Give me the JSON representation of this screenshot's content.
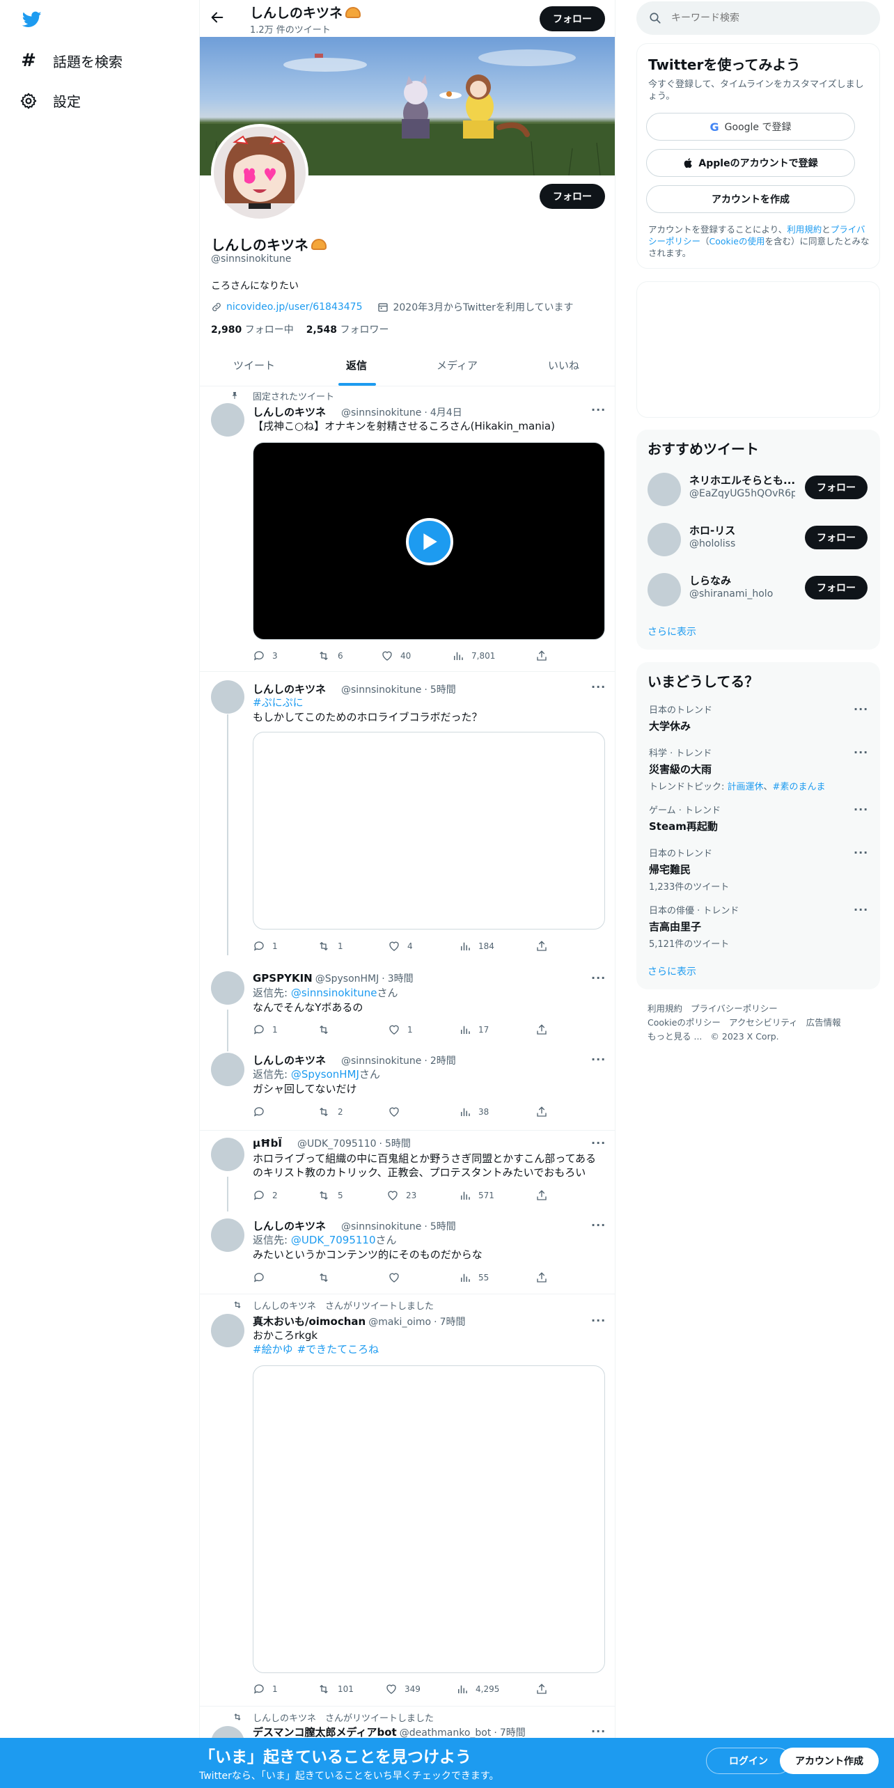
{
  "nav": {
    "explore": "話題を検索",
    "settings": "設定"
  },
  "header": {
    "name": "しんしのキツネ",
    "tweet_count": "1.2万 件のツイート",
    "follow": "フォロー"
  },
  "profile": {
    "name": "しんしのキツネ",
    "handle": "@sinnsinokitune",
    "bio": "ころさんになりたい",
    "link": "nicovideo.jp/user/61843475",
    "joined": "2020年3月からTwitterを利用しています",
    "following_count": "2,980",
    "following_label": "フォロー中",
    "followers_count": "2,548",
    "followers_label": "フォロワー",
    "follow": "フォロー"
  },
  "tabs": {
    "tweets": "ツイート",
    "replies": "返信",
    "media": "メディア",
    "likes": "いいね"
  },
  "tweets": [
    {
      "context": "固定されたツイート",
      "name": "しんしのキツネ",
      "handle": "@sinnsinokitune",
      "time": "4月4日",
      "text": "【戌神こ○ね】オナキンを射精させるころさん(Hikakin_mania)",
      "replies": "3",
      "retweets": "6",
      "likes": "40",
      "views": "7,801"
    },
    {
      "name": "しんしのキツネ",
      "handle": "@sinnsinokitune",
      "time": "5時間",
      "hashtag": "#ぷにぷに",
      "text": "もしかしてこのためのホロライブコラボだった？",
      "replies": "1",
      "retweets": "1",
      "likes": "4",
      "views": "184"
    },
    {
      "name": "GPSPYKIN",
      "handle": "@SpysonHMJ",
      "time": "3時間",
      "reply_prefix": "返信先:",
      "reply_to": "@sinnsinokitune",
      "reply_suffix": "さん",
      "text": "なんでそんなYボあるの",
      "replies": "1",
      "retweets": "",
      "likes": "1",
      "views": "17"
    },
    {
      "name": "しんしのキツネ",
      "handle": "@sinnsinokitune",
      "time": "2時間",
      "reply_prefix": "返信先:",
      "reply_to": "@SpysonHMJ",
      "reply_suffix": "さん",
      "text": "ガシャ回してないだけ",
      "replies": "",
      "retweets": "2",
      "likes": "",
      "views": "38"
    },
    {
      "name": "µĦbÏ",
      "handle": "@UDK_7095110",
      "time": "5時間",
      "text1": "ホロライブって組織の中に百鬼組とか野うさぎ同盟とかすこん部ってある",
      "text2": "のキリスト教のカトリック、正教会、プロテスタントみたいでおもろい",
      "replies": "2",
      "retweets": "5",
      "likes": "23",
      "views": "571"
    },
    {
      "name": "しんしのキツネ",
      "handle": "@sinnsinokitune",
      "time": "5時間",
      "reply_prefix": "返信先:",
      "reply_to": "@UDK_7095110",
      "reply_suffix": "さん",
      "text": "みたいというかコンテンツ的にそのものだからな",
      "replies": "",
      "retweets": "",
      "likes": "",
      "views": "55"
    },
    {
      "context": "しんしのキツネ　さんがリツイートしました",
      "name": "真木おいも/oimochan",
      "handle": "@maki_oimo",
      "time": "7時間",
      "text": "おかころrkgk",
      "hashtag1": "#絵かゆ",
      "hashtag2": "#できたてころね",
      "replies": "1",
      "retweets": "101",
      "likes": "349",
      "views": "4,295"
    },
    {
      "context": "しんしのキツネ　さんがリツイートしました",
      "name": "デスマンコ膣太郎メディアbot",
      "handle": "@deathmanko_bot",
      "time": "7時間"
    }
  ],
  "search": {
    "placeholder": "キーワード検索"
  },
  "signup": {
    "title": "Twitterを使ってみよう",
    "subtitle": "今すぐ登録して、タイムラインをカスタマイズしましょう。",
    "google": "Google で登録",
    "apple": "Appleのアカウントで登録",
    "create": "アカウントを作成",
    "legal_1": "アカウントを登録することにより、",
    "legal_terms": "利用規約",
    "legal_2": "と",
    "legal_privacy": "プライバシーポリシー",
    "legal_3": "（",
    "legal_cookie": "Cookieの使用",
    "legal_4": "を含む）に同意したとみなされます。"
  },
  "recommend": {
    "title": "おすすめツイート",
    "users": [
      {
        "name": "ネリホエルそらとも...",
        "handle": "@EaZqyUG5hQOvR6p",
        "follow": "フォロー"
      },
      {
        "name": "ホロ-リス",
        "handle": "@hololiss",
        "follow": "フォロー"
      },
      {
        "name": "しらなみ",
        "handle": "@shiranami_holo",
        "follow": "フォロー"
      }
    ],
    "more": "さらに表示"
  },
  "trends": {
    "title": "いまどうしてる？",
    "items": [
      {
        "category": "日本のトレンド",
        "title": "大学休み"
      },
      {
        "category": "科学 · トレンド",
        "title": "災害級の大雨",
        "topic_prefix": "トレンドトピック: ",
        "topic1": "計画運休",
        "topic_sep": "、",
        "topic2": "#素のまんま"
      },
      {
        "category": "ゲーム · トレンド",
        "title": "Steam再起動"
      },
      {
        "category": "日本のトレンド",
        "title": "帰宅難民",
        "count": "1,233件のツイート"
      },
      {
        "category": "日本の俳優 · トレンド",
        "title": "吉高由里子",
        "count": "5,121件のツイート"
      }
    ],
    "more": "さらに表示"
  },
  "footer": {
    "terms": "利用規約",
    "privacy": "プライバシーポリシー",
    "cookie": "Cookieのポリシー",
    "accessibility": "アクセシビリティ",
    "ads": "広告情報",
    "more": "もっと見る ...",
    "copyright": "© 2023 X Corp."
  },
  "bottom": {
    "title": "「いま」起きていることを見つけよう",
    "subtitle": "Twitterなら、「いま」起きていることをいち早くチェックできます。",
    "login": "ログイン",
    "signup": "アカウント作成"
  },
  "colors": {
    "accent": "#1d9bf0",
    "dark": "#0f1419",
    "secondary_text": "#536471",
    "panel": "#f7f9f9"
  }
}
